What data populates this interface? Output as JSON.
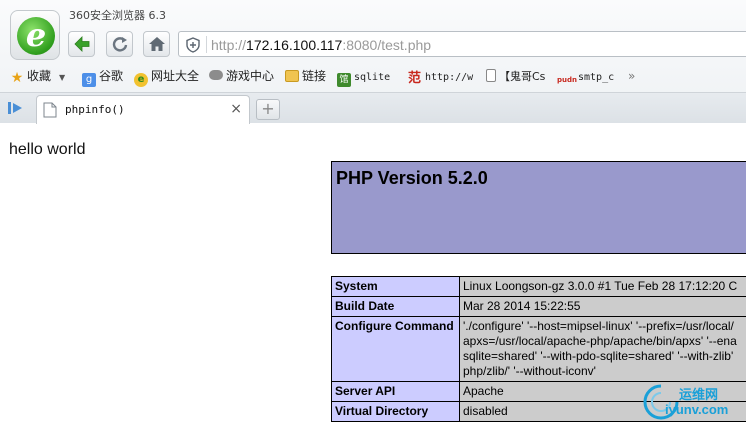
{
  "window": {
    "title": "360安全浏览器 6.3"
  },
  "address_bar": {
    "scheme": "http://",
    "host": "172.16.100.117",
    "rest": ":8080/test.php"
  },
  "bookmarks": [
    {
      "label": "收藏",
      "icon": "star-icon"
    },
    {
      "label": "谷歌",
      "icon": "google-icon"
    },
    {
      "label": "网址大全",
      "icon": "web-nav-icon"
    },
    {
      "label": "游戏中心",
      "icon": "gamepad-icon"
    },
    {
      "label": "链接",
      "icon": "folder-icon"
    },
    {
      "label": "sqlite",
      "icon": "sqlite-icon"
    },
    {
      "label": "http://w",
      "icon": "fan-icon"
    },
    {
      "label": "【鬼哥Cs",
      "icon": "page-icon"
    },
    {
      "label": "smtp_c",
      "icon": "pudn-icon"
    }
  ],
  "tab": {
    "label": "phpinfo()",
    "close": "×",
    "new_tab": "+"
  },
  "content": {
    "hello": "hello world",
    "php_version": "PHP Version 5.2.0",
    "rows": [
      {
        "key": "System",
        "value": [
          "Linux Loongson-gz 3.0.0 #1 Tue Feb 28 17:12:20 C"
        ]
      },
      {
        "key": "Build Date",
        "value": [
          "Mar 28 2014 15:22:55"
        ]
      },
      {
        "key": "Configure Command",
        "value": [
          "'./configure' '--host=mipsel-linux' '--prefix=/usr/local/",
          "apxs=/usr/local/apache-php/apache/bin/apxs' '--ena",
          "sqlite=shared' '--with-pdo-sqlite=shared' '--with-zlib'",
          "php/zlib/' '--without-iconv'"
        ]
      },
      {
        "key": "Server API",
        "value": [
          "Apache"
        ]
      },
      {
        "key": "Virtual Directory",
        "value": [
          "disabled"
        ]
      }
    ]
  },
  "watermark": {
    "cn": "运维网",
    "en": "iyunv.com"
  },
  "colors": {
    "php_header": "#9999cc",
    "php_key": "#ccccff",
    "php_value": "#cccccc"
  }
}
